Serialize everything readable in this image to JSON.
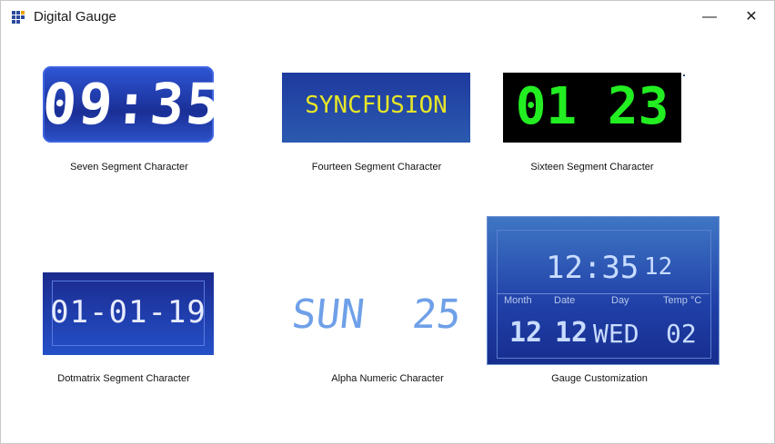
{
  "window": {
    "title": "Digital Gauge",
    "minimize_label": "—",
    "close_label": "✕"
  },
  "gauges": {
    "seven": {
      "value": "09:35",
      "caption": "Seven Segment Character",
      "color": "#ffffff",
      "bg": "#1e3fb0"
    },
    "fourteen": {
      "value": "SYNCFUSION",
      "caption": "Fourteen Segment Character",
      "color": "#e6e628",
      "bg": "#1f4b9a"
    },
    "sixteen": {
      "value": "01 23",
      "caption": "Sixteen Segment Character",
      "color": "#22ee22",
      "bg": "#000000"
    },
    "dotmatrix": {
      "value": "01-01-19",
      "caption": "Dotmatrix Segment Character",
      "color": "#e8ecff",
      "bg": "#1b2f9a"
    },
    "alpha": {
      "value": "SUN  25",
      "caption": "Alpha Numeric Character",
      "color": "#6fa0e8"
    },
    "custom": {
      "time": "12:35",
      "side": "12",
      "labels": [
        "Month",
        "Date",
        "Day",
        "Temp °C"
      ],
      "values": [
        "12",
        "12",
        "WED",
        "02"
      ],
      "caption": "Gauge Customization",
      "color": "#c8dcff"
    }
  }
}
